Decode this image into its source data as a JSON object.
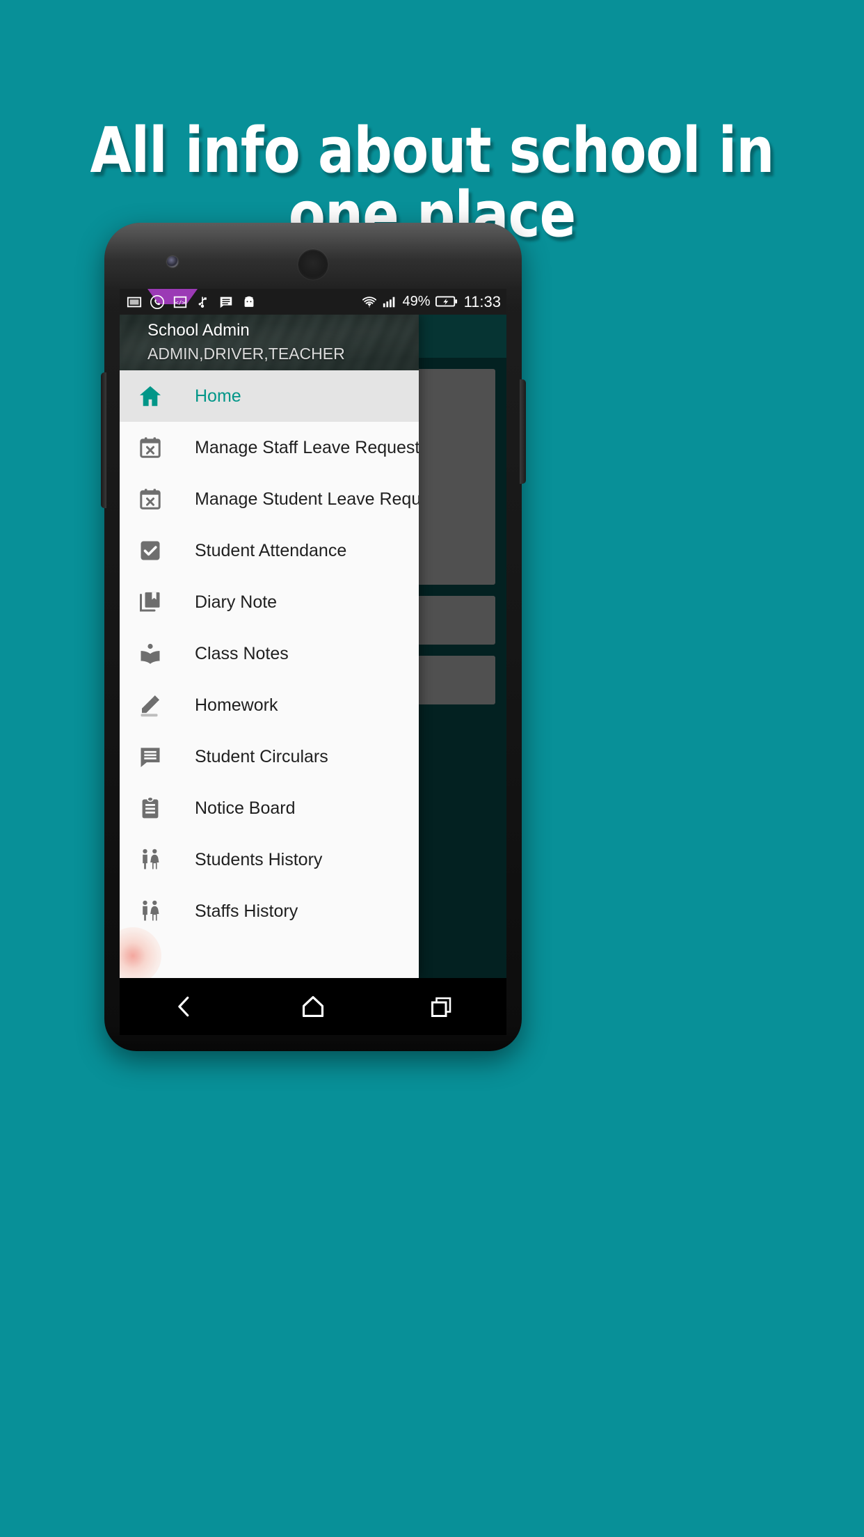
{
  "page": {
    "background_color": "#089098",
    "headline_line1": "All info about school in",
    "headline_line2": "one place"
  },
  "status_bar": {
    "left_icons": [
      {
        "name": "screenshot-icon",
        "label": "screenshot"
      },
      {
        "name": "whatsapp-icon",
        "label": "whatsapp"
      },
      {
        "name": "code-icon",
        "label": "developer"
      },
      {
        "name": "usb-debug-icon",
        "label": "usb-debugging"
      },
      {
        "name": "message-icon",
        "label": "messages"
      },
      {
        "name": "android-icon",
        "label": "android-system"
      }
    ],
    "wifi_icon": "wifi-icon",
    "signal_icon": "cellular-signal-icon",
    "battery_percent": "49%",
    "battery_icon": "battery-charging-icon",
    "time": "11:33"
  },
  "drawer": {
    "user_name": "School Admin",
    "user_roles": "ADMIN,DRIVER,TEACHER",
    "selected_color": "#009688",
    "items": [
      {
        "label": "Home",
        "icon": "home-icon",
        "selected": true
      },
      {
        "label": "Manage Staff Leave Request",
        "icon": "calendar-cancel-icon",
        "selected": false
      },
      {
        "label": "Manage Student Leave Request",
        "icon": "calendar-cancel-icon",
        "selected": false
      },
      {
        "label": "Student Attendance",
        "icon": "checkbox-checked-icon",
        "selected": false
      },
      {
        "label": "Diary Note",
        "icon": "bookmark-library-icon",
        "selected": false
      },
      {
        "label": "Class Notes",
        "icon": "local-library-icon",
        "selected": false
      },
      {
        "label": "Homework",
        "icon": "pencil-edit-icon",
        "selected": false
      },
      {
        "label": "Student Circulars",
        "icon": "comment-lines-icon",
        "selected": false
      },
      {
        "label": "Notice Board",
        "icon": "clipboard-icon",
        "selected": false
      },
      {
        "label": "Students History",
        "icon": "people-pair-icon",
        "selected": false
      },
      {
        "label": "Staffs History",
        "icon": "people-pair-icon",
        "selected": false
      }
    ]
  },
  "navigation_bar": {
    "back": "back-icon",
    "home": "home-outline-icon",
    "recents": "recents-icon"
  }
}
